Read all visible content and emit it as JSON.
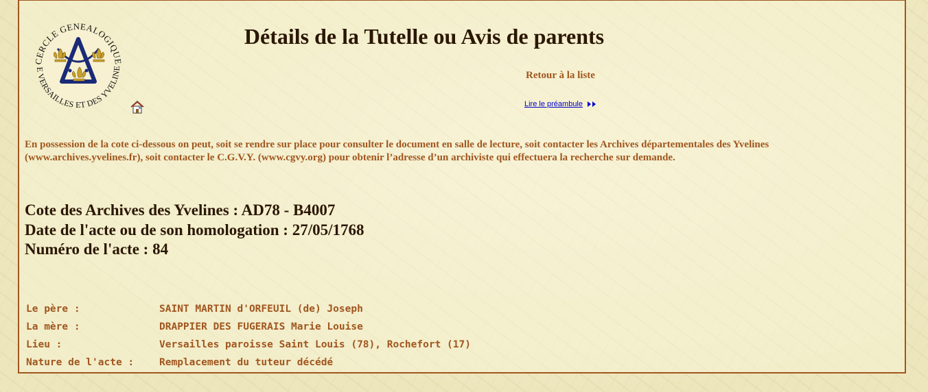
{
  "header": {
    "title": "Détails de la Tutelle ou Avis de parents",
    "back_link": "Retour à la liste",
    "preamble_link": "Lire le préambule"
  },
  "logo": {
    "top_text": "CERCLE GENEALOGIQUE",
    "bottom_text": "DE VERSAILLES ET DES YVELINES",
    "icon": "fleur-de-lis-compass-emblem"
  },
  "intro": {
    "text": "En possession de la cote ci-dessous on peut, soit se rendre sur place pour consulter le document en salle de lecture, soit contacter les Archives départementales des Yvelines (www.archives.yvelines.fr), soit contacter le C.G.V.Y. (www.cgvy.org) pour obtenir l’adresse d’un archiviste qui effectuera la recherche sur demande."
  },
  "facts": {
    "cote": "Cote des Archives des Yvelines : AD78 - B4007",
    "date": "Date de l'acte ou de son homologation : 27/05/1768",
    "numero": "Numéro de l'acte : 84"
  },
  "details": [
    {
      "label": "Le père :",
      "value": "SAINT MARTIN d'ORFEUIL (de) Joseph"
    },
    {
      "label": "La mère :",
      "value": "DRAPPIER DES FUGERAIS Marie Louise"
    },
    {
      "label": "Lieu :",
      "value": "Versailles paroisse Saint Louis (78), Rochefort (17)"
    },
    {
      "label": "Nature de l'acte :",
      "value": "Remplacement du tuteur décédé"
    }
  ],
  "colors": {
    "accent": "#a0561f",
    "title": "#2b1705",
    "link": "#0000cc",
    "logo_blue": "#1a2a78",
    "logo_gold": "#c9a12a"
  }
}
